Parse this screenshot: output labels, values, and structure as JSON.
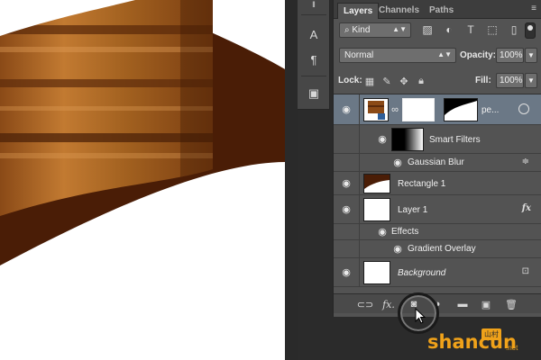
{
  "colors": {
    "panel_bg": "#535353",
    "selected_row": "#6b7886",
    "canvas_bg": "#ffffff",
    "wood_dark": "#5a2a0c",
    "wood_mid": "#9b5a21",
    "wood_light": "#d08a3a",
    "brown_shape": "#4a1d06",
    "watermark": "#f0a21a"
  },
  "tool_strip": {
    "items": [
      {
        "name": "collapse-arrows-icon",
        "glyph": "‖"
      },
      {
        "name": "character-panel-icon",
        "glyph": "A"
      },
      {
        "name": "paragraph-panel-icon",
        "glyph": "¶"
      },
      {
        "name": "swatches-icon",
        "glyph": "▣"
      }
    ]
  },
  "tabs": [
    {
      "label": "Layers",
      "active": true
    },
    {
      "label": "Channels",
      "active": false
    },
    {
      "label": "Paths",
      "active": false
    }
  ],
  "filter": {
    "kind_label": "Kind",
    "filter_icons": [
      "image-filter-icon",
      "adjustment-filter-icon",
      "type-filter-icon",
      "shape-filter-icon",
      "smart-object-filter-icon"
    ]
  },
  "blend": {
    "mode": "Normal",
    "opacity_label": "Opacity:",
    "opacity_value": "100%",
    "fill_label": "Fill:",
    "fill_value": "100%",
    "lock_label": "Lock:"
  },
  "layers": [
    {
      "name": "pe...",
      "type": "smart-object",
      "selected": true
    },
    {
      "name": "Smart Filters",
      "type": "sub"
    },
    {
      "name": "Gaussian Blur",
      "type": "filter"
    },
    {
      "name": "Rectangle 1",
      "type": "shape"
    },
    {
      "name": "Layer 1",
      "type": "pixel",
      "fx": "fx"
    },
    {
      "name": "Effects",
      "type": "effects"
    },
    {
      "name": "Gradient Overlay",
      "type": "effect"
    },
    {
      "name": "Background",
      "type": "background"
    }
  ],
  "bottom_icons": [
    "link-layers-icon",
    "fx-icon",
    "add-mask-icon",
    "adjustment-layer-icon",
    "new-group-icon",
    "new-layer-icon",
    "delete-layer-icon"
  ],
  "watermark": {
    "main": "shancun",
    "suffix": ".net",
    "badge": "山村"
  }
}
